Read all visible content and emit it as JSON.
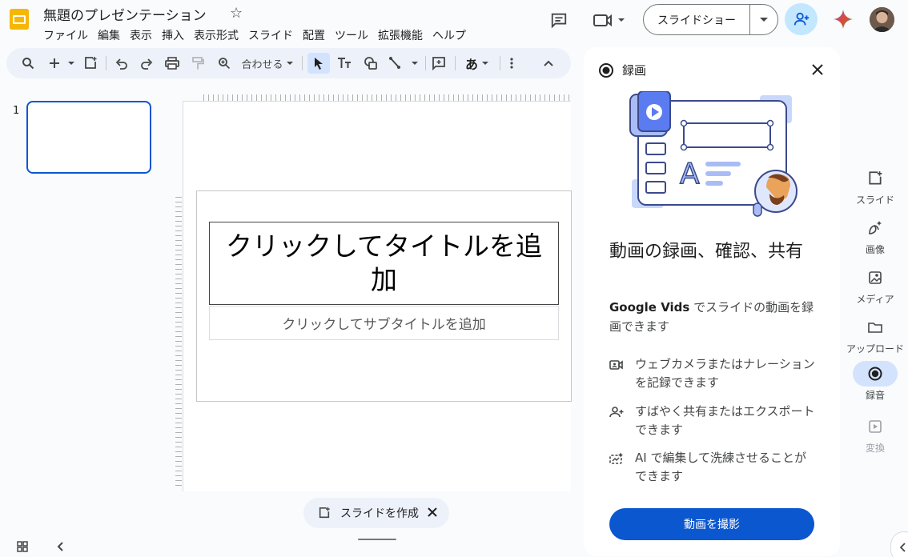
{
  "header": {
    "doc_title": "無題のプレゼンテーション",
    "slideshow_label": "スライドショー",
    "menu": [
      "ファイル",
      "編集",
      "表示",
      "挿入",
      "表示形式",
      "スライド",
      "配置",
      "ツール",
      "拡張機能",
      "ヘルプ"
    ]
  },
  "toolbar": {
    "zoom_label": "合わせる"
  },
  "filmstrip": {
    "slide_number": "1"
  },
  "slide": {
    "title_placeholder": "クリックしてタイトルを追加",
    "subtitle_placeholder": "クリックしてサブタイトルを追加"
  },
  "canvas": {
    "make_slide_label": "スライドを作成"
  },
  "panel": {
    "title": "録画",
    "heading": "動画の録画、確認、共有",
    "desc_brand": "Google Vids",
    "desc_rest": " でスライドの動画を録画できます",
    "features": [
      "ウェブカメラまたはナレーションを記録できます",
      "すばやく共有またはエクスポートできます",
      "AI で編集して洗練させることができます"
    ],
    "record_button": "動画を撮影"
  },
  "rail": {
    "items": [
      "スライド",
      "画像",
      "メディア",
      "アップロード",
      "録音",
      "変換"
    ]
  },
  "colors": {
    "accent": "#0b57d0",
    "active_bg": "#d3e3fd",
    "toolbar_bg": "#edf2fa",
    "logo": "#f6b704"
  }
}
